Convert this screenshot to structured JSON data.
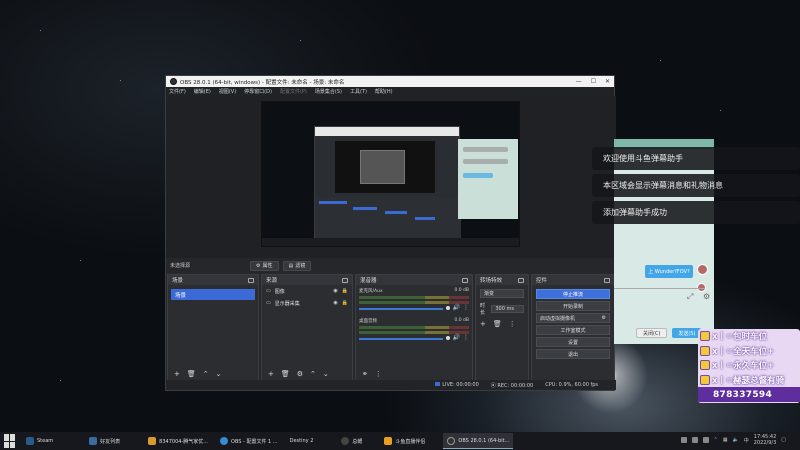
{
  "obs": {
    "title": "OBS 28.0.1 (64-bit, windows) - 配置文件: 未命名 - 场景: 未命名",
    "menu": [
      "文件(F)",
      "编辑(E)",
      "视图(V)",
      "停靠窗口(D)",
      "配置文件(P)",
      "场景集合(S)",
      "工具(T)",
      "帮助(H)"
    ],
    "scene_label": "未选择源",
    "props_btn": "属性",
    "filter_btn": "滤镜",
    "docks": {
      "scenes": {
        "title": "场景",
        "items": [
          "场景"
        ]
      },
      "sources": {
        "title": "来源",
        "items": [
          "图像",
          "显示器采集"
        ]
      },
      "mixer": {
        "title": "混音器",
        "tracks": [
          {
            "name": "麦克风/Aux",
            "db": "0.0 dB"
          },
          {
            "name": "桌面音频",
            "db": "0.0 dB"
          }
        ]
      },
      "transitions": {
        "title": "转场特效",
        "selected": "渐变",
        "duration_label": "时长",
        "duration_value": "300 ms"
      },
      "controls": {
        "title": "控件",
        "buttons": [
          "停止推流",
          "开始录制",
          "启动虚拟摄像机",
          "工作室模式",
          "设置",
          "退出"
        ]
      }
    },
    "status": {
      "live": "LIVE: 00:00:00",
      "rec": "REC: 00:00:00",
      "cpu": "CPU: 0.9%, 60.00 fps"
    }
  },
  "chat": {
    "bubble": "上 Wunder?FOV?",
    "btn_close": "关闭(C)",
    "btn_send": "发送(S)"
  },
  "toasts": [
    "欢迎使用斗鱼弹幕助手",
    "本区域会显示弹幕消息和礼物消息",
    "添加弹幕助手成功"
  ],
  "overlay": {
    "lines": [
      "x丨=包时车位",
      "x丨=全天车位+",
      "x丨=永久车位+",
      "x丨=赫瑟总督有骑"
    ],
    "phone": "878337594"
  },
  "taskbar": {
    "items": [
      {
        "label": "Steam",
        "color": "#2a5a8a"
      },
      {
        "label": "好友列表",
        "color": "#3a6aa0"
      },
      {
        "label": "8347004-腾气家优...",
        "color": "#d89a2a"
      },
      {
        "label": "OBS - 配置文件 1 ...",
        "color": "#3a8ad0"
      },
      {
        "label": "Destiny 2",
        "color": "#555"
      },
      {
        "label": "总鳃",
        "color": "#444"
      },
      {
        "label": "斗鱼直播伴侣",
        "color": "#e8a020"
      },
      {
        "label": "OBS 28.0.1 (64-bit...",
        "color": "#333"
      }
    ],
    "time": "17:45:42",
    "date": "2022/9/3"
  }
}
